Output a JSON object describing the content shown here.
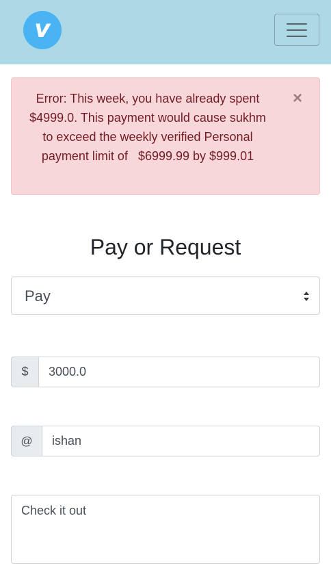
{
  "navbar": {
    "logo_letter": "v",
    "menu_icon": "hamburger-icon"
  },
  "alert": {
    "message": "Error: This week, you have already spent $4999.0. This payment would cause sukhm to exceed the weekly verified Personal payment limit of   $6999.99 by $999.01",
    "close_label": "×"
  },
  "form": {
    "title": "Pay or Request",
    "action": {
      "selected": "Pay"
    },
    "amount": {
      "prefix": "$",
      "value": "3000.0"
    },
    "recipient": {
      "prefix": "@",
      "value": "ishan"
    },
    "note": {
      "value": "Check it out"
    }
  },
  "colors": {
    "navbar_bg": "#add8e6",
    "logo_bg": "#4ab3f4",
    "alert_bg": "#f8d7da",
    "alert_text": "#721c24"
  }
}
